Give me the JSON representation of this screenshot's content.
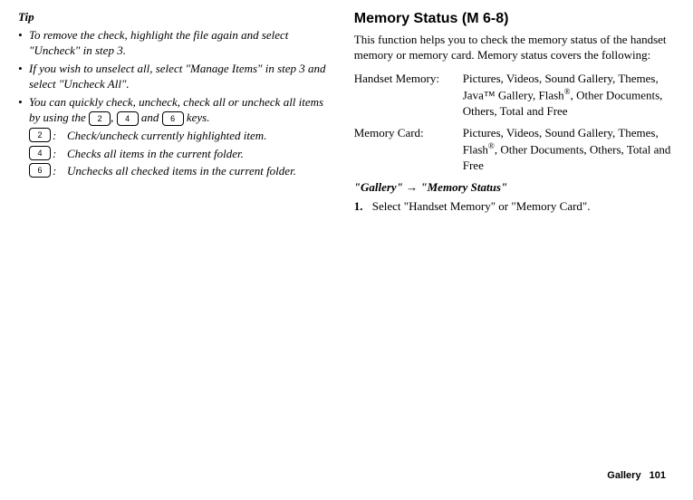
{
  "left": {
    "tip_heading": "Tip",
    "bullets": {
      "b1": "To remove the check, highlight the file again and select \"Uncheck\" in step 3.",
      "b2": "If you wish to unselect all, select \"Manage Items\" in step 3 and select \"Uncheck All\".",
      "b3_pre": "You can quickly check, uncheck, check all or uncheck all items by using the ",
      "b3_mid1": ", ",
      "b3_mid2": " and ",
      "b3_post": " keys."
    },
    "key_labels": {
      "k2": "2",
      "k4": "4",
      "k6": "6"
    },
    "key_rows": {
      "r1": {
        "colon": ":",
        "desc": "Check/uncheck currently highlighted item."
      },
      "r2": {
        "colon": ":",
        "desc": "Checks all items in the current folder."
      },
      "r3": {
        "colon": ":",
        "desc": "Unchecks all checked items in the current folder."
      }
    }
  },
  "right": {
    "heading": "Memory Status ",
    "heading_menu_pre": "(M 6-8)",
    "intro": "This function helps you to check the memory status of the handset memory or memory card. Memory status covers the following:",
    "rows": {
      "handset_label": "Handset Memory:",
      "handset_val_pre": "Pictures, Videos, Sound Gallery, Themes, Java™ Gallery, Flash",
      "handset_val_post": ", Other Documents, Others, Total and Free",
      "card_label": "Memory Card:",
      "card_val_pre": "Pictures, Videos, Sound Gallery, Themes, Flash",
      "card_val_post": ", Other Documents, Others, Total and Free",
      "reg": "®"
    },
    "nav": {
      "n1": "\"Gallery\"",
      "arrow": "→",
      "n2": "\"Memory Status\""
    },
    "step": {
      "num": "1.",
      "text": "Select \"Handset Memory\" or \"Memory Card\"."
    }
  },
  "footer": {
    "section": "Gallery",
    "page": "101"
  }
}
